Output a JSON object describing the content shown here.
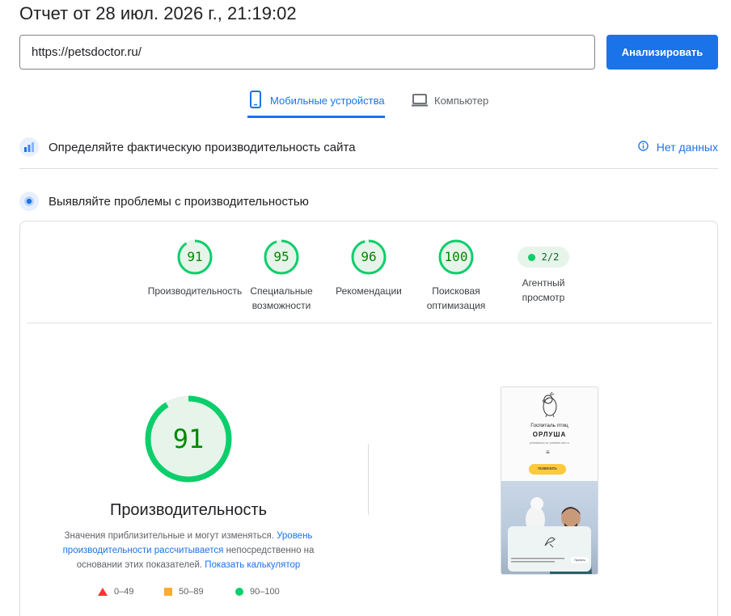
{
  "report": {
    "title": "Отчет от 28 июл. 2026 г., 21:19:02"
  },
  "search": {
    "url": "https://petsdoctor.ru/",
    "analyze_label": "Анализировать"
  },
  "tabs": [
    {
      "label": "Мобильные устройства",
      "active": true,
      "icon": "mobile-phone-icon"
    },
    {
      "label": "Компьютер",
      "active": false,
      "icon": "laptop-icon"
    }
  ],
  "field_section": {
    "title": "Определяйте фактическую производительность сайта",
    "no_data_label": "Нет данных",
    "icon": "field-data-icon"
  },
  "lab_section": {
    "title": "Выявляйте проблемы с производительностью",
    "icon": "lab-data-icon"
  },
  "categories": [
    {
      "score": "91",
      "label": "Производительность",
      "fraction": 0.91
    },
    {
      "score": "95",
      "label": "Специальные возможности",
      "fraction": 0.95
    },
    {
      "score": "96",
      "label": "Рекомендации",
      "fraction": 0.96
    },
    {
      "score": "100",
      "label": "Поисковая оптимизация",
      "fraction": 1.0
    }
  ],
  "agentic": {
    "value": "2/2",
    "label": "Агентный просмотр"
  },
  "main_gauge": {
    "score": "91",
    "fraction": 0.91,
    "title": "Производительность",
    "desc_prefix": "Значения приблизительные и могут изменяться.",
    "desc_link1": "Уровень производительности рассчитывается",
    "desc_middle": "непосредственно на основании этих показателей.",
    "desc_link2": "Показать калькулятор"
  },
  "legend": {
    "fail": "0–49",
    "average": "50–89",
    "pass": "90–100"
  },
  "screenshot": {
    "line1": "Госпиталь птиц",
    "line2": "ОРЛУША",
    "line3": "petsdoctor.ru orlusha-vet.ru",
    "menu_glyph": "≡",
    "button": "позвонить",
    "modal_button": "Принять"
  },
  "colors": {
    "accent": "#1a73e8",
    "pass": "#0cce6b",
    "pass_text": "#008800",
    "average": "#ffaa33",
    "fail": "#ff3333"
  }
}
